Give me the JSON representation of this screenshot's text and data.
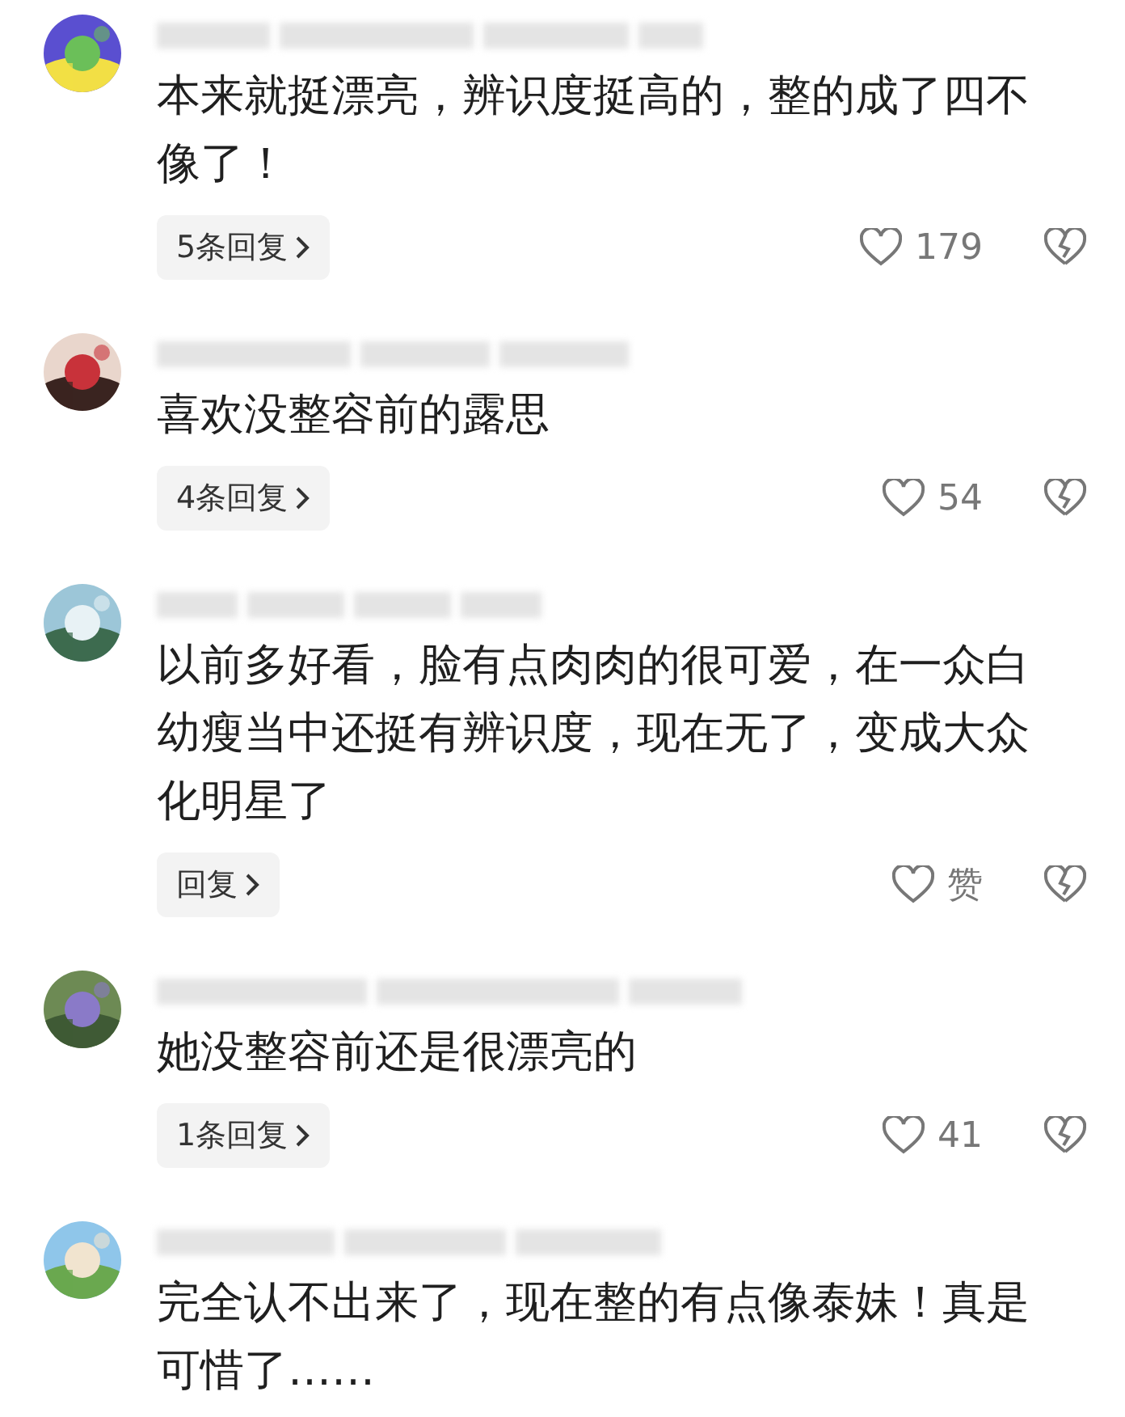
{
  "comments": [
    {
      "text": "本来就挺漂亮，辨识度挺高的，整的成了四不像了！",
      "reply_label": "5条回复",
      "likes": "179"
    },
    {
      "text": "喜欢没整容前的露思",
      "reply_label": "4条回复",
      "likes": "54"
    },
    {
      "text": "以前多好看，脸有点肉肉的很可爱，在一众白幼瘦当中还挺有辨识度，现在无了，变成大众化明星了",
      "reply_label": "回复",
      "likes": "赞"
    },
    {
      "text": "她没整容前还是很漂亮的",
      "reply_label": "1条回复",
      "likes": "41"
    },
    {
      "text": "完全认不出来了，现在整的有点像泰妹！真是可惜了……"
    }
  ]
}
